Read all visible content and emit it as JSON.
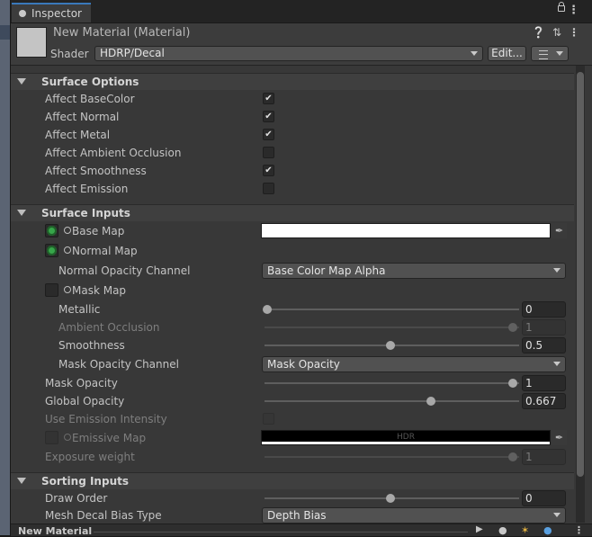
{
  "window": {
    "tab_title": "Inspector"
  },
  "header": {
    "material_title": "New Material (Material)",
    "shader_label": "Shader",
    "shader_value": "HDRP/Decal",
    "edit_button": "Edit..."
  },
  "surface_options": {
    "title": "Surface Options",
    "rows": [
      {
        "label": "Affect BaseColor",
        "checked": true
      },
      {
        "label": "Affect Normal",
        "checked": true
      },
      {
        "label": "Affect Metal",
        "checked": true
      },
      {
        "label": "Affect Ambient Occlusion",
        "checked": false
      },
      {
        "label": "Affect Smoothness",
        "checked": true
      },
      {
        "label": "Affect Emission",
        "checked": false
      }
    ]
  },
  "surface_inputs": {
    "title": "Surface Inputs",
    "base_map": "Base Map",
    "normal_map": "Normal Map",
    "normal_opacity_channel": {
      "label": "Normal Opacity Channel",
      "value": "Base Color Map Alpha"
    },
    "mask_map": "Mask Map",
    "metallic": {
      "label": "Metallic",
      "value": "0",
      "fraction": 0
    },
    "ambient_occlusion": {
      "label": "Ambient Occlusion",
      "value": "1",
      "fraction": 1
    },
    "smoothness": {
      "label": "Smoothness",
      "value": "0.5",
      "fraction": 0.5
    },
    "mask_opacity_channel": {
      "label": "Mask Opacity Channel",
      "value": "Mask Opacity"
    },
    "mask_opacity": {
      "label": "Mask Opacity",
      "value": "1",
      "fraction": 1
    },
    "global_opacity": {
      "label": "Global Opacity",
      "value": "0.667",
      "fraction": 0.667
    },
    "use_emission_intensity": "Use Emission Intensity",
    "emissive_map": {
      "label": "Emissive Map",
      "hdr": "HDR"
    },
    "exposure_weight": {
      "label": "Exposure weight",
      "value": "1",
      "fraction": 1
    }
  },
  "sorting_inputs": {
    "title": "Sorting Inputs",
    "draw_order": {
      "label": "Draw Order",
      "value": "0",
      "fraction": 0.5
    },
    "mesh_decal_bias_type": {
      "label": "Mesh Decal Bias Type",
      "value": "Depth Bias"
    }
  },
  "footer": {
    "name": "New Material"
  },
  "colors": {
    "accent": "#3a79bb",
    "panel": "#383838",
    "check_on": "#37a64a"
  }
}
